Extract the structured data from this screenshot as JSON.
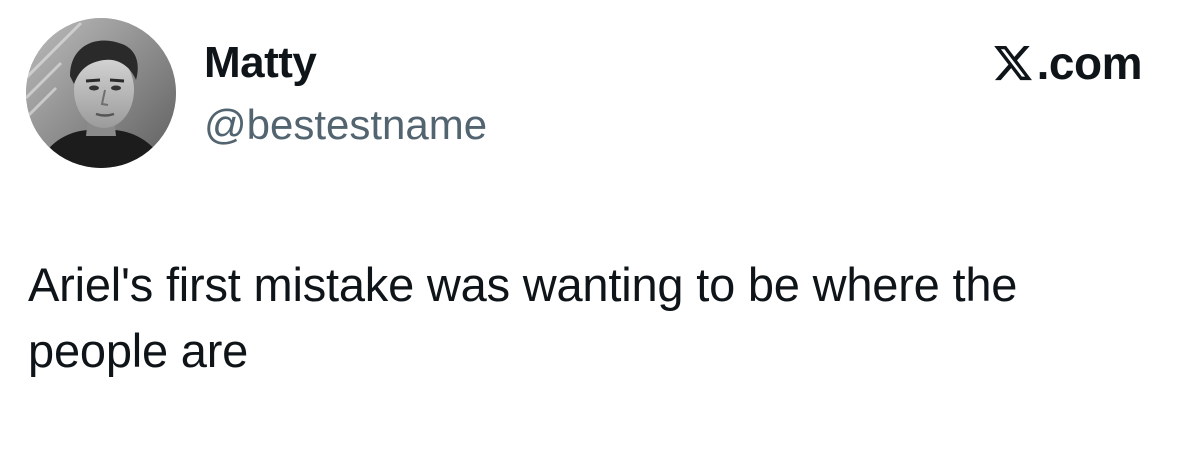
{
  "author": {
    "display_name": "Matty",
    "handle": "@bestestname",
    "avatar_icon": "profile-photo-grayscale"
  },
  "brand": {
    "logo_icon": "x-logo-icon",
    "text": ".com"
  },
  "tweet": {
    "text": "Ariel's first mistake was wanting to be where the people are"
  },
  "colors": {
    "primary_text": "#0f1419",
    "secondary_text": "#536471",
    "background": "#ffffff"
  }
}
